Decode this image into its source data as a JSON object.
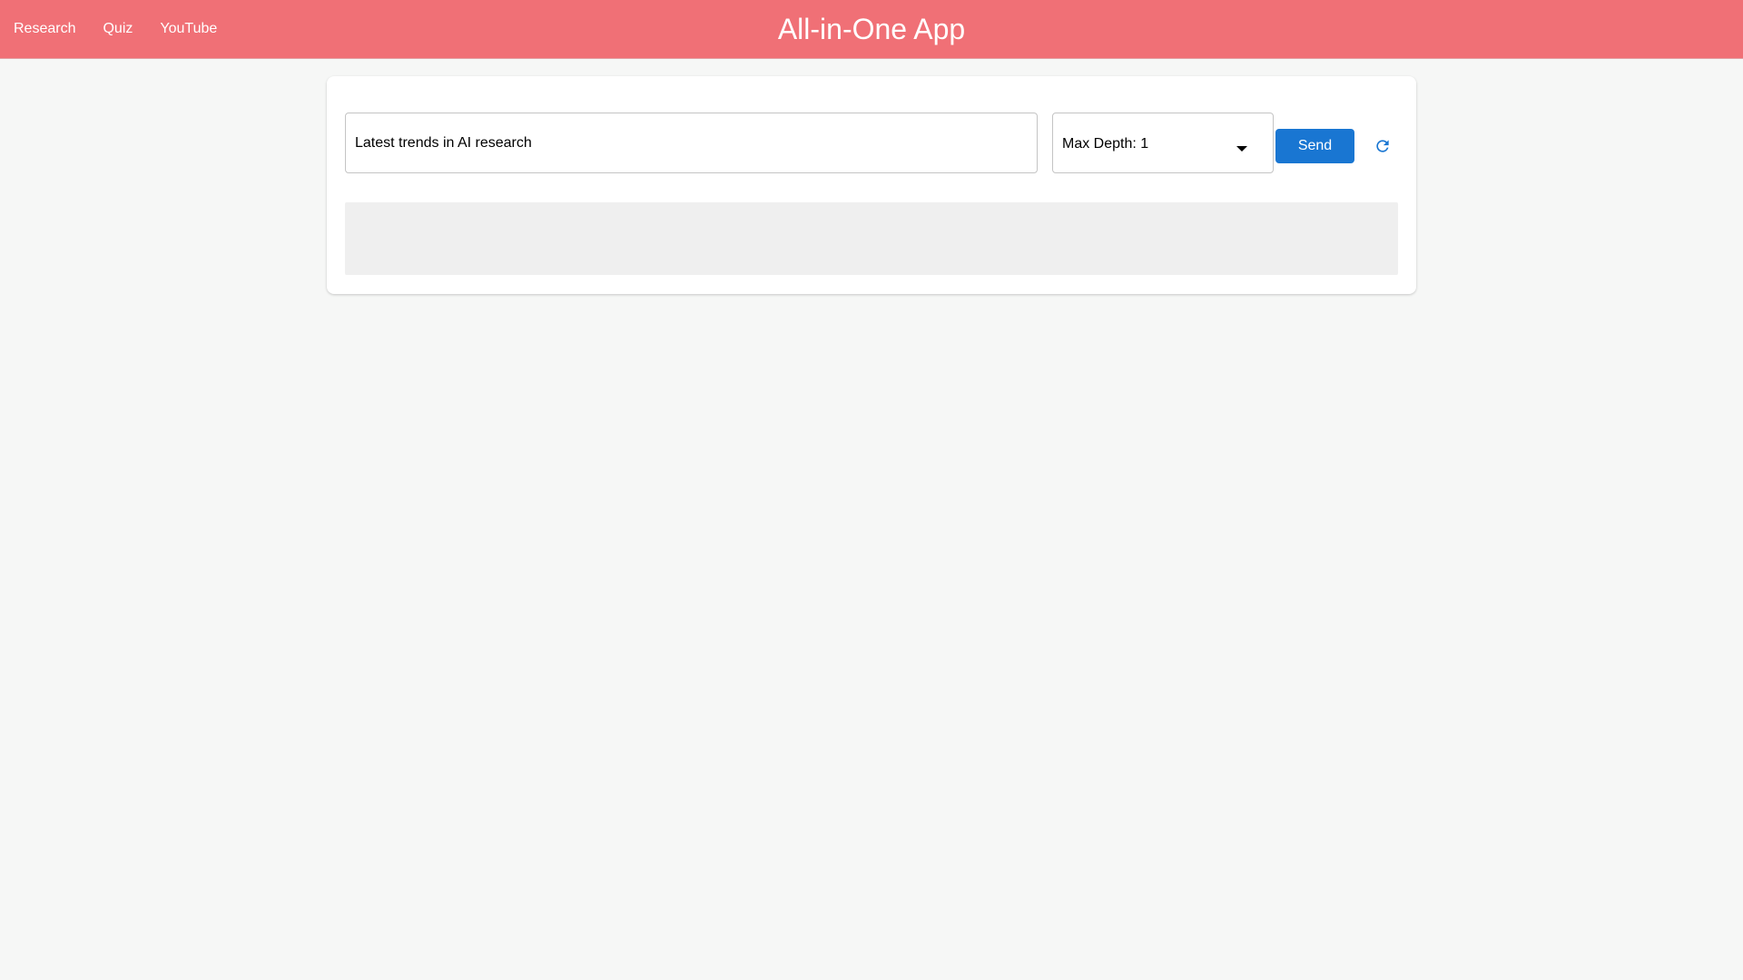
{
  "app": {
    "title": "All-in-One App"
  },
  "nav": {
    "items": [
      {
        "label": "Research"
      },
      {
        "label": "Quiz"
      },
      {
        "label": "YouTube"
      }
    ]
  },
  "search": {
    "value": "Latest trends in AI research"
  },
  "depth_select": {
    "selected": "Max Depth: 1"
  },
  "actions": {
    "send_label": "Send",
    "refresh_icon": "refresh-icon"
  },
  "colors": {
    "header": "#f07076",
    "accent": "#1976d2",
    "background": "#f6f7f6",
    "result_area": "#efefef"
  }
}
